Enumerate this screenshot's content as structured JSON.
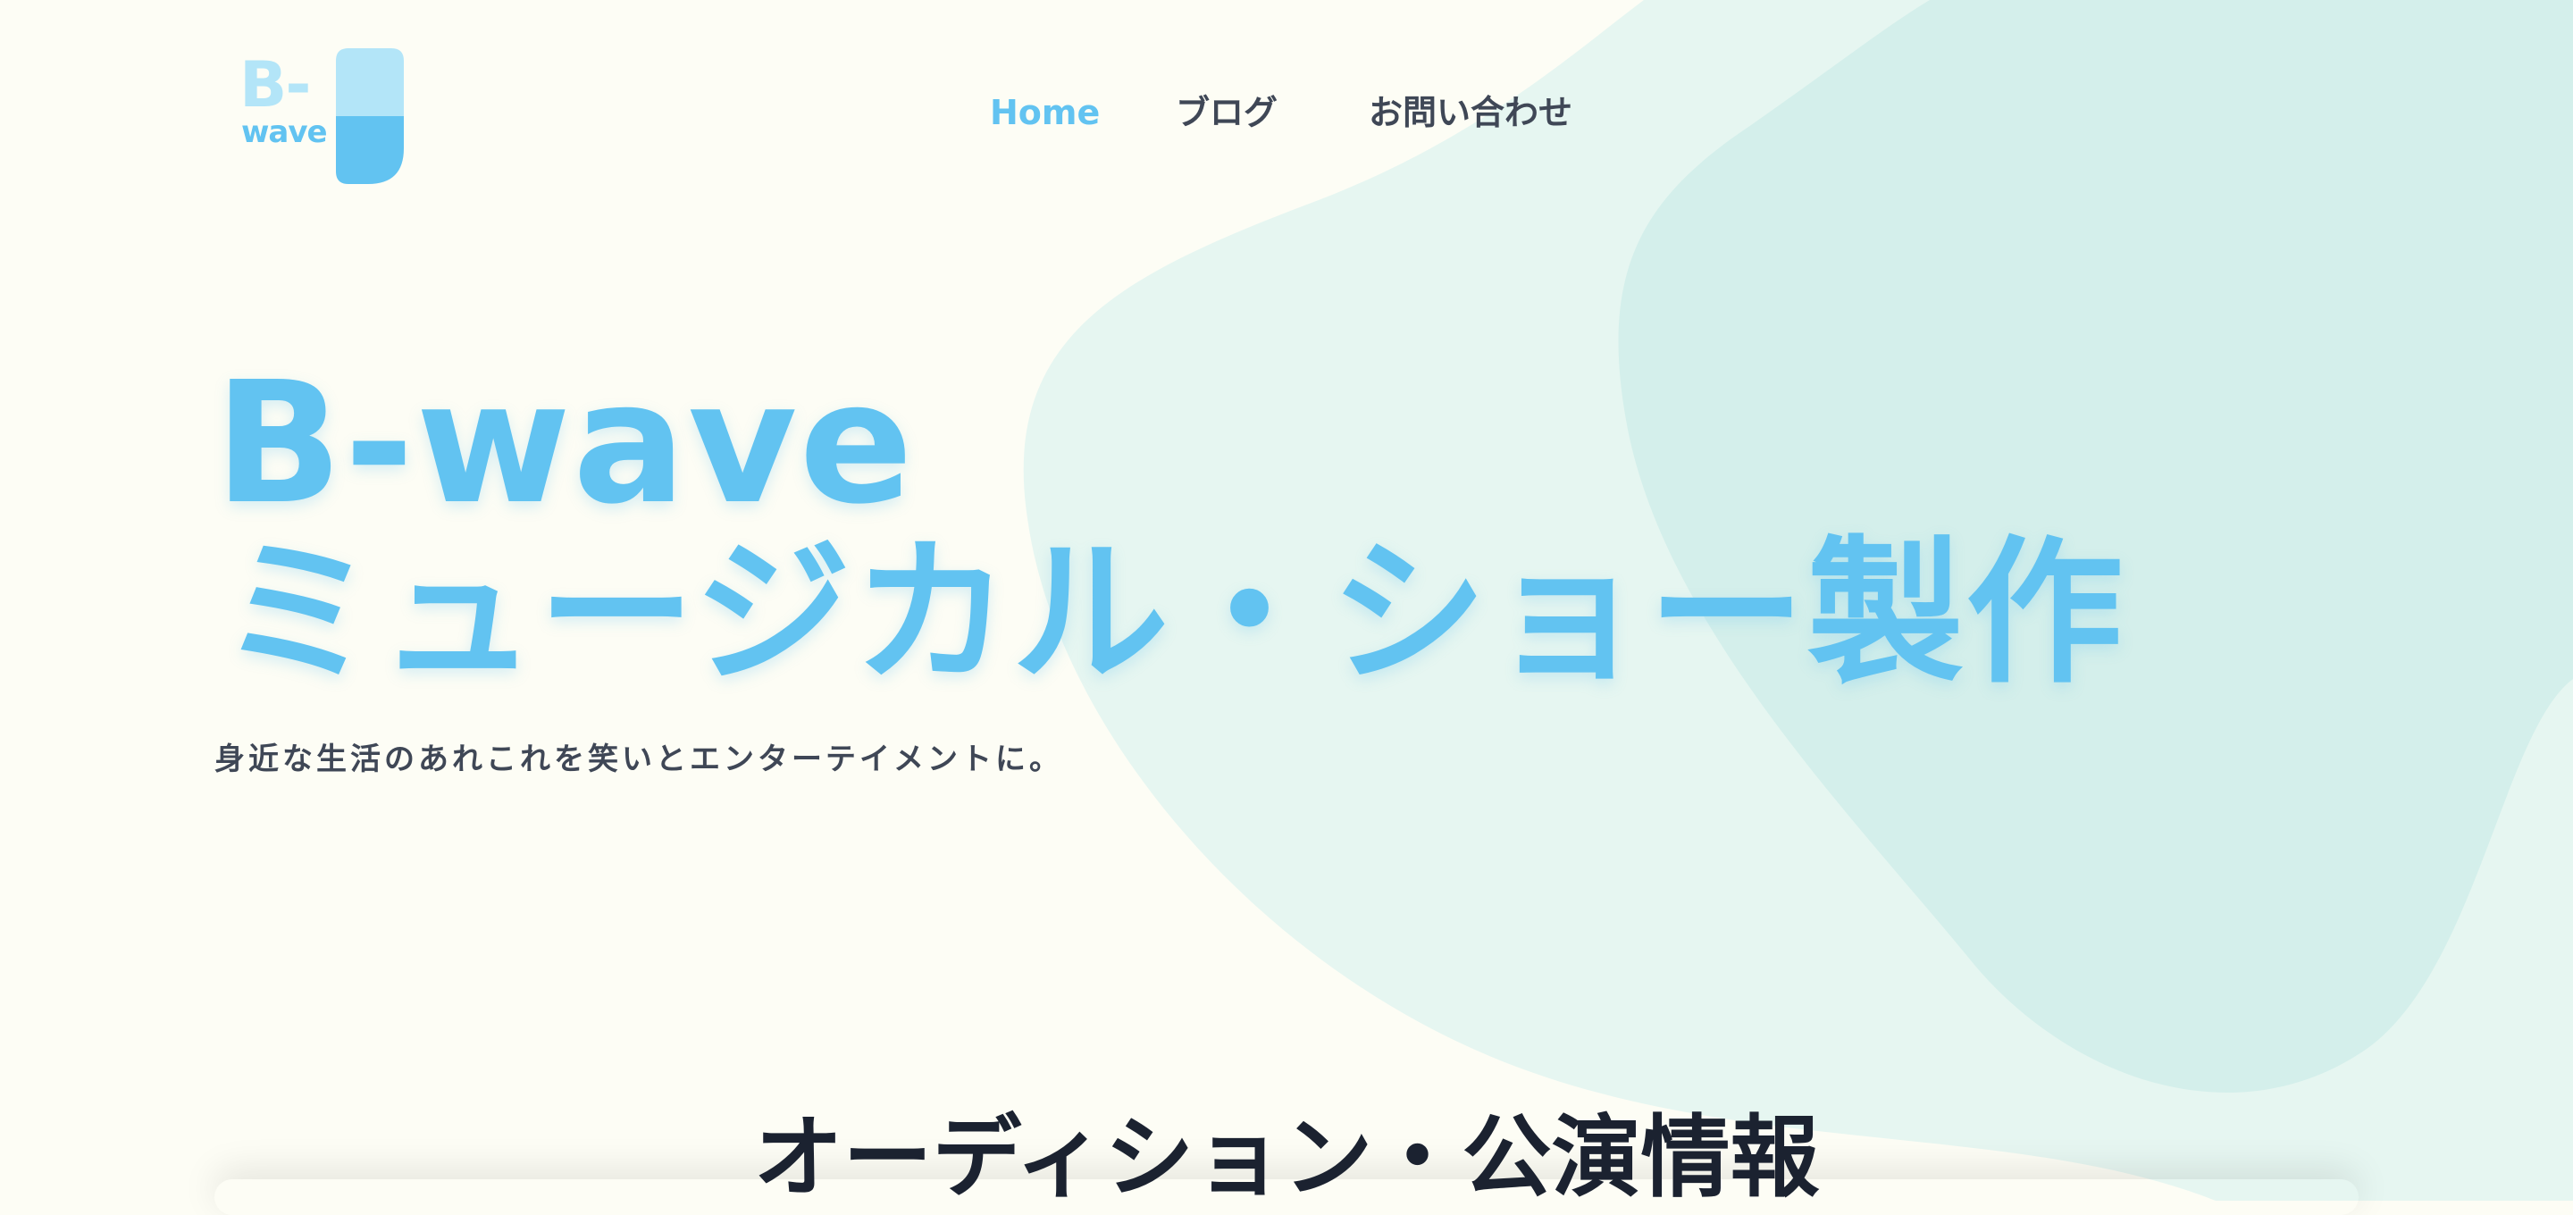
{
  "logo": {
    "letters": "B-",
    "word": "wave",
    "colors": {
      "light": "#b3e5f8",
      "accent": "#62c3f1"
    }
  },
  "nav": {
    "items": [
      {
        "label": "Home",
        "active": true
      },
      {
        "label": "ブログ",
        "active": false
      },
      {
        "label": "お問い合わせ",
        "active": false
      }
    ]
  },
  "hero": {
    "title_line1": "B-wave",
    "title_line2": "ミュージカル・ショー製作",
    "tagline": "身近な生活のあれこれを笑いとエンターテイメントに。"
  },
  "section": {
    "title": "オーディション・公演情報"
  },
  "colors": {
    "background": "#fdfdf5",
    "accent": "#62c3f1",
    "blob_light": "#e6f6f1",
    "blob_dark": "#d4efeb",
    "nav_text": "#3f4756",
    "heading_text": "#1b2230"
  }
}
